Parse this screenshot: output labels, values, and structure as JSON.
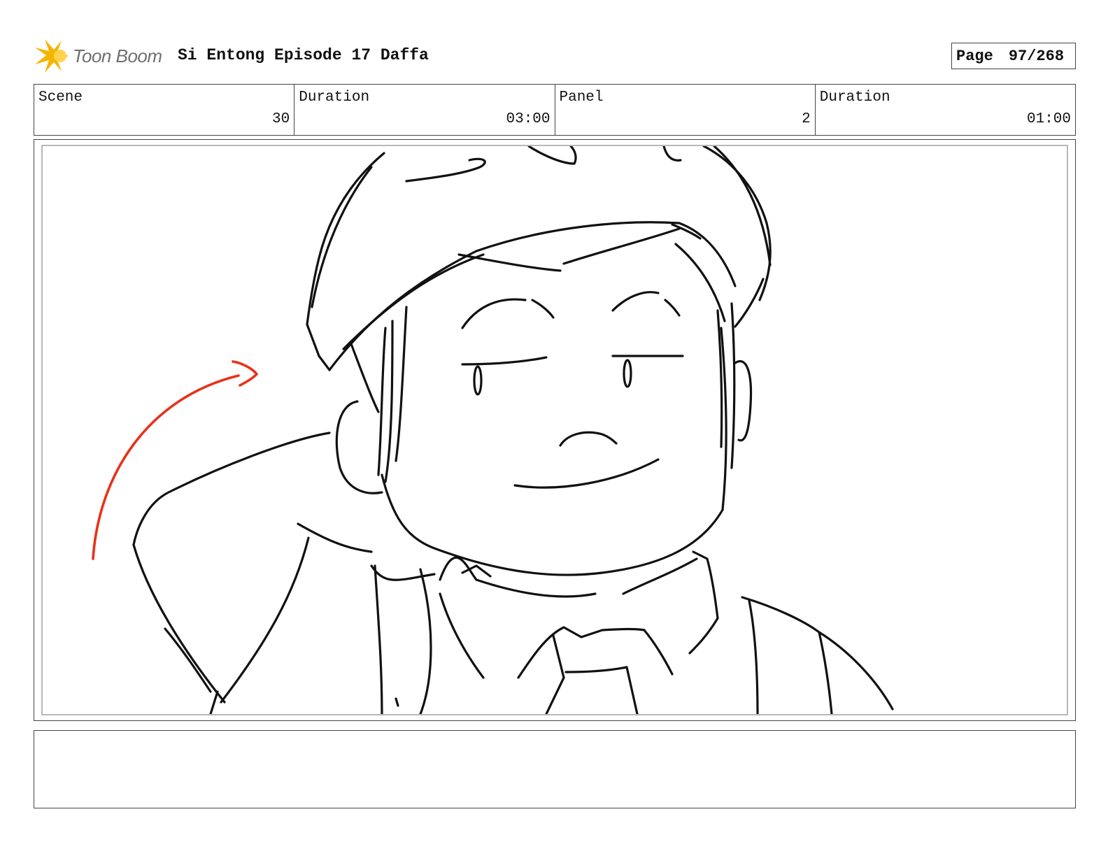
{
  "header": {
    "logo_text": "Toon Boom",
    "title": "Si Entong Episode 17 Daffa",
    "page_label": "Page",
    "page_value": "97/268"
  },
  "info": {
    "scene_label": "Scene",
    "scene_value": "30",
    "scene_duration_label": "Duration",
    "scene_duration_value": "03:00",
    "panel_label": "Panel",
    "panel_value": "2",
    "panel_duration_label": "Duration",
    "panel_duration_value": "01:00"
  },
  "panel": {
    "icons": [
      "character-sketch",
      "motion-arrow"
    ],
    "stroke_color": "#111111",
    "arrow_color": "#e8321a"
  },
  "logo": {
    "star_color": "#f5b400",
    "text_color": "#6f6f6f"
  }
}
